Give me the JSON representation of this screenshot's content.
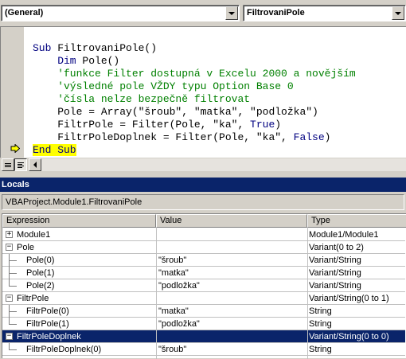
{
  "code_window": {
    "object_combo": "(General)",
    "procedure_combo": "FiltrovaniPole",
    "lines": [
      {
        "parts": [
          {
            "t": "Sub ",
            "c": "kw"
          },
          {
            "t": "FiltrovaniPole()",
            "c": "plain"
          }
        ]
      },
      {
        "parts": [
          {
            "t": "    Dim ",
            "c": "kw"
          },
          {
            "t": "Pole()",
            "c": "plain"
          }
        ]
      },
      {
        "parts": [
          {
            "t": "    'funkce Filter dostupná v Excelu 2000 a novějším",
            "c": "cm"
          }
        ]
      },
      {
        "parts": [
          {
            "t": "    'výsledné pole VŽDY typu Option Base 0",
            "c": "cm"
          }
        ]
      },
      {
        "parts": [
          {
            "t": "    'čísla nelze bezpečně filtrovat",
            "c": "cm"
          }
        ]
      },
      {
        "parts": [
          {
            "t": "    Pole = Array(\"šroub\", \"matka\", \"podložka\")",
            "c": "plain"
          }
        ]
      },
      {
        "parts": [
          {
            "t": "    FiltrPole = Filter(Pole, \"ka\", ",
            "c": "plain"
          },
          {
            "t": "True",
            "c": "kw"
          },
          {
            "t": ")",
            "c": "plain"
          }
        ]
      },
      {
        "parts": [
          {
            "t": "    FiltrPoleDoplnek = Filter(Pole, \"ka\", ",
            "c": "plain"
          },
          {
            "t": "False",
            "c": "kw"
          },
          {
            "t": ")",
            "c": "plain"
          }
        ]
      },
      {
        "parts": [
          {
            "t": "End Sub",
            "c": "kw hl"
          }
        ]
      }
    ]
  },
  "locals": {
    "title": "Locals",
    "context": "VBAProject.Module1.FiltrovaniPole",
    "headers": {
      "expression": "Expression",
      "value": "Value",
      "type": "Type"
    },
    "rows": [
      {
        "expr": "Module1",
        "value": "",
        "type": "Module1/Module1",
        "level": 0,
        "expander": "+",
        "selected": false
      },
      {
        "expr": "Pole",
        "value": "",
        "type": "Variant(0 to 2)",
        "level": 0,
        "expander": "-",
        "selected": false
      },
      {
        "expr": "Pole(0)",
        "value": "\"šroub\"",
        "type": "Variant/String",
        "level": 1,
        "expander": "",
        "selected": false
      },
      {
        "expr": "Pole(1)",
        "value": "\"matka\"",
        "type": "Variant/String",
        "level": 1,
        "expander": "",
        "selected": false
      },
      {
        "expr": "Pole(2)",
        "value": "\"podložka\"",
        "type": "Variant/String",
        "level": 1,
        "expander": "",
        "selected": false
      },
      {
        "expr": "FiltrPole",
        "value": "",
        "type": "Variant/String(0 to 1)",
        "level": 0,
        "expander": "-",
        "selected": false
      },
      {
        "expr": "FiltrPole(0)",
        "value": "\"matka\"",
        "type": "String",
        "level": 1,
        "expander": "",
        "selected": false
      },
      {
        "expr": "FiltrPole(1)",
        "value": "\"podložka\"",
        "type": "String",
        "level": 1,
        "expander": "",
        "selected": false
      },
      {
        "expr": "FiltrPoleDoplnek",
        "value": "",
        "type": "Variant/String(0 to 0)",
        "level": 0,
        "expander": "-",
        "selected": true
      },
      {
        "expr": "FiltrPoleDoplnek(0)",
        "value": "\"šroub\"",
        "type": "String",
        "level": 1,
        "expander": "",
        "selected": false
      }
    ]
  },
  "colors": {
    "keyword": "#000080",
    "comment": "#008000",
    "execution_highlight": "#ffff00",
    "selection": "#0a246a"
  },
  "icons": {
    "execution_pointer": "yellow-arrow-icon",
    "procedure_view": "procedure-view-icon",
    "full_module_view": "full-module-view-icon"
  }
}
